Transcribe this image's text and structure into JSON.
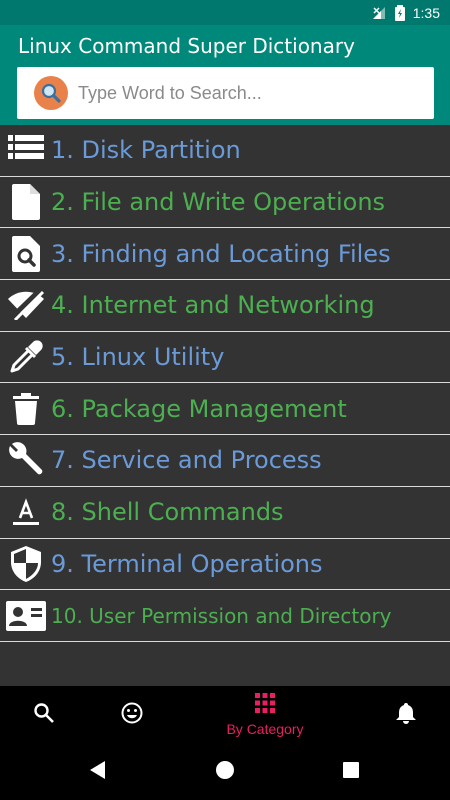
{
  "status_bar": {
    "time": "1:35"
  },
  "app": {
    "title": "Linux Command Super Dictionary"
  },
  "search": {
    "placeholder": "Type Word to Search..."
  },
  "categories": [
    {
      "label": "1. Disk Partition",
      "color": "#6a9ad8",
      "icon": "server-icon"
    },
    {
      "label": "2. File and Write Operations",
      "color": "#4caf50",
      "icon": "file-icon"
    },
    {
      "label": "3. Finding and Locating Files",
      "color": "#6a9ad8",
      "icon": "find-file-icon"
    },
    {
      "label": "4. Internet and Networking",
      "color": "#4caf50",
      "icon": "wifi-off-icon"
    },
    {
      "label": "5. Linux Utility",
      "color": "#6a9ad8",
      "icon": "eyedropper-icon"
    },
    {
      "label": "6. Package Management",
      "color": "#4caf50",
      "icon": "trash-icon"
    },
    {
      "label": "7. Service and Process",
      "color": "#6a9ad8",
      "icon": "wrench-icon"
    },
    {
      "label": "8. Shell Commands",
      "color": "#4caf50",
      "icon": "text-format-icon"
    },
    {
      "label": "9. Terminal Operations",
      "color": "#6a9ad8",
      "icon": "shield-icon"
    },
    {
      "label": "10. User Permission and Directory",
      "color": "#4caf50",
      "icon": "contact-card-icon"
    }
  ],
  "bottom_nav": {
    "active_label": "By Category",
    "active_color": "#e91e63"
  }
}
